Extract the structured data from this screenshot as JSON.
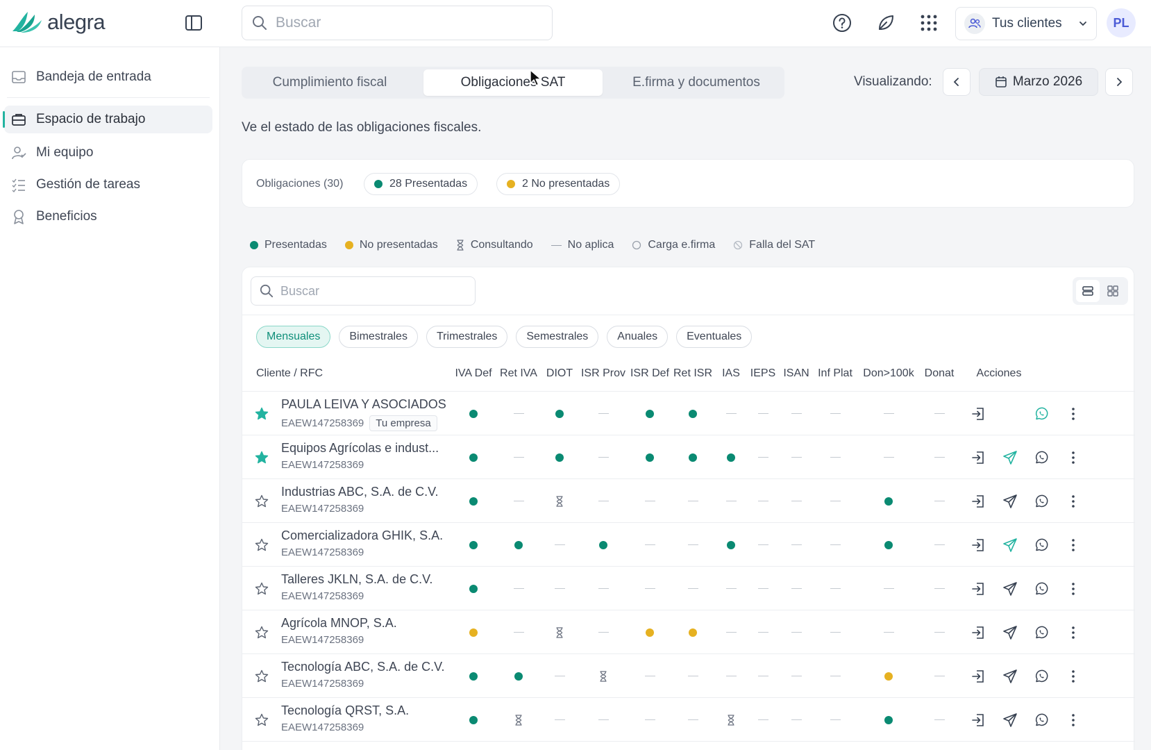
{
  "app": {
    "logo_text": "alegra",
    "search_placeholder": "Buscar",
    "client_switch": "Tus clientes",
    "avatar_initials": "PL"
  },
  "sidebar": {
    "items": [
      {
        "label": "Bandeja de entrada",
        "icon": "inbox-icon"
      },
      {
        "label": "Espacio de trabajo",
        "icon": "briefcase-icon",
        "active": true
      },
      {
        "label": "Mi equipo",
        "icon": "team-icon"
      },
      {
        "label": "Gestión de tareas",
        "icon": "task-list-icon"
      },
      {
        "label": "Beneficios",
        "icon": "award-icon"
      }
    ]
  },
  "tabs": [
    {
      "label": "Cumplimiento fiscal"
    },
    {
      "label": "Obligaciones SAT",
      "active": true
    },
    {
      "label": "E.firma y documentos"
    }
  ],
  "period": {
    "label": "Visualizando:",
    "value": "Marzo 2026"
  },
  "subtitle": "Ve el estado de las obligaciones fiscales.",
  "summary": {
    "label": "Obligaciones (30)",
    "presented": "28 Presentadas",
    "not_presented": "2 No presentadas"
  },
  "legend": [
    "Presentadas",
    "No presentadas",
    "Consultando",
    "No aplica",
    "Carga e.firma",
    "Falla del SAT"
  ],
  "table": {
    "search_placeholder": "Buscar",
    "filters": [
      "Mensuales",
      "Bimestrales",
      "Trimestrales",
      "Semestrales",
      "Anuales",
      "Eventuales"
    ],
    "active_filter": 0,
    "client_header": "Cliente / RFC",
    "columns": [
      "IVA Def",
      "Ret IVA",
      "DIOT",
      "ISR Prov",
      "ISR Def",
      "Ret ISR",
      "IAS",
      "IEPS",
      "ISAN",
      "Inf Plat",
      "Don>100k",
      "Donat"
    ],
    "actions_header": "Acciones",
    "colors": {
      "presented": "#0a8a72",
      "not_presented": "#e6b121",
      "accent": "#22b3a0"
    },
    "rows": [
      {
        "name": "PAULA LEIVA Y ASOCIADOS",
        "rfc": "EAEW147258369",
        "tag": "Tu empresa",
        "starred": true,
        "statuses": [
          "P",
          "N",
          "P",
          "N",
          "P",
          "P",
          "N",
          "N",
          "N",
          "N",
          "N",
          "N"
        ],
        "send": "none"
      },
      {
        "name": "Equipos Agrícolas e indust...",
        "rfc": "EAEW147258369",
        "tag": "",
        "starred": true,
        "statuses": [
          "P",
          "N",
          "P",
          "N",
          "P",
          "P",
          "P",
          "N",
          "N",
          "N",
          "N",
          "N"
        ],
        "send": "accent"
      },
      {
        "name": "Industrias ABC, S.A. de C.V.",
        "rfc": "EAEW147258369",
        "tag": "",
        "starred": false,
        "statuses": [
          "P",
          "N",
          "C",
          "N",
          "N",
          "N",
          "N",
          "N",
          "N",
          "N",
          "P",
          "N"
        ],
        "send": "normal"
      },
      {
        "name": "Comercializadora GHIK, S.A.",
        "rfc": "EAEW147258369",
        "tag": "",
        "starred": false,
        "statuses": [
          "P",
          "P",
          "N",
          "P",
          "N",
          "N",
          "P",
          "N",
          "N",
          "N",
          "P",
          "N"
        ],
        "send": "accent"
      },
      {
        "name": "Talleres JKLN, S.A. de C.V.",
        "rfc": "EAEW147258369",
        "tag": "",
        "starred": false,
        "statuses": [
          "P",
          "N",
          "N",
          "N",
          "N",
          "N",
          "N",
          "N",
          "N",
          "N",
          "N",
          "N"
        ],
        "send": "normal"
      },
      {
        "name": "Agrícola MNOP, S.A.",
        "rfc": "EAEW147258369",
        "tag": "",
        "starred": false,
        "statuses": [
          "Y",
          "N",
          "C",
          "N",
          "Y",
          "Y",
          "N",
          "N",
          "N",
          "N",
          "N",
          "N"
        ],
        "send": "normal"
      },
      {
        "name": "Tecnología ABC, S.A. de C.V.",
        "rfc": "EAEW147258369",
        "tag": "",
        "starred": false,
        "statuses": [
          "P",
          "P",
          "N",
          "C",
          "N",
          "N",
          "N",
          "N",
          "N",
          "N",
          "Y",
          "N"
        ],
        "send": "normal"
      },
      {
        "name": "Tecnología QRST, S.A.",
        "rfc": "EAEW147258369",
        "tag": "",
        "starred": false,
        "statuses": [
          "P",
          "C",
          "N",
          "N",
          "N",
          "N",
          "C",
          "N",
          "N",
          "N",
          "P",
          "N"
        ],
        "send": "normal"
      }
    ]
  }
}
